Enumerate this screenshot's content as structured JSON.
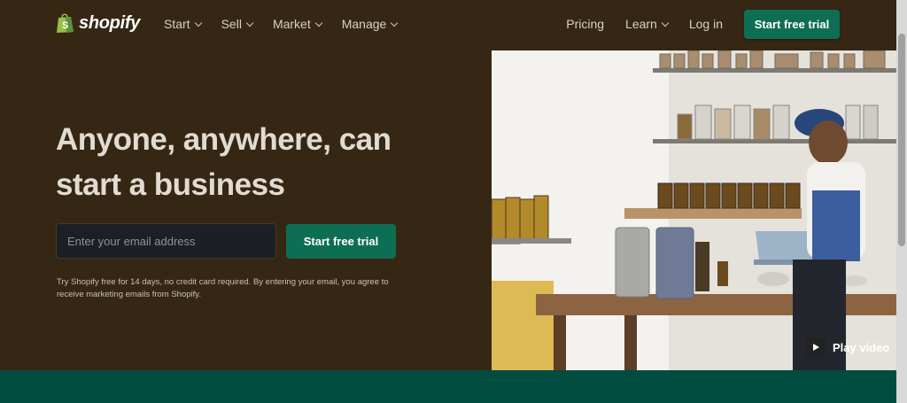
{
  "brand": {
    "name": "shopify",
    "accent": "#0e6e54",
    "background": "#352713"
  },
  "nav": {
    "left": [
      {
        "label": "Start"
      },
      {
        "label": "Sell"
      },
      {
        "label": "Market"
      },
      {
        "label": "Manage"
      }
    ],
    "right": [
      {
        "label": "Pricing"
      },
      {
        "label": "Learn"
      },
      {
        "label": "Log in"
      }
    ],
    "cta": "Start free trial"
  },
  "hero": {
    "headline": "Anyone, anywhere, can start a business",
    "email_placeholder": "Enter your email address",
    "cta": "Start free trial",
    "fineprint": "Try Shopify free for 14 days, no credit card required. By entering your email, you agree to receive marketing emails from Shopify."
  },
  "media": {
    "play_label": "Play video",
    "icon": "play-icon"
  }
}
